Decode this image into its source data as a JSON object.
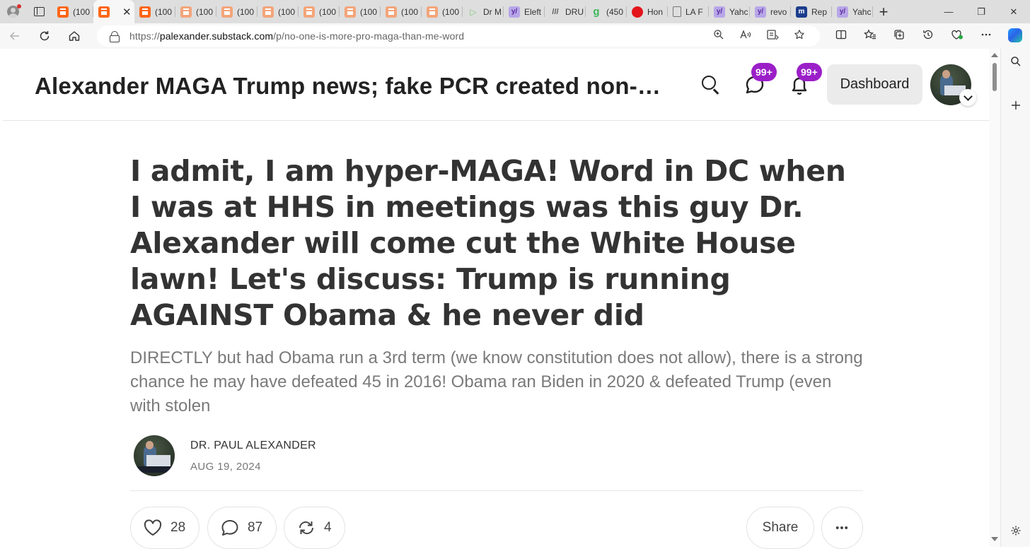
{
  "browser": {
    "tabs": [
      {
        "label": "(100",
        "icon": "substack-icon",
        "active": false
      },
      {
        "label": "",
        "icon": "substack-icon",
        "active": true
      },
      {
        "label": "(100",
        "icon": "substack-icon",
        "active": false
      },
      {
        "label": "(100",
        "icon": "substack-icon",
        "active": false
      },
      {
        "label": "(100",
        "icon": "substack-icon",
        "active": false
      },
      {
        "label": "(100",
        "icon": "substack-icon",
        "active": false
      },
      {
        "label": "(100",
        "icon": "substack-icon",
        "active": false
      },
      {
        "label": "(100",
        "icon": "substack-icon",
        "active": false
      },
      {
        "label": "(100",
        "icon": "substack-icon",
        "active": false
      },
      {
        "label": "(100",
        "icon": "substack-icon",
        "active": false
      },
      {
        "label": "Dr M",
        "icon": "play-icon",
        "active": false
      },
      {
        "label": "Eleft",
        "icon": "yahoo-icon",
        "active": false
      },
      {
        "label": "DRU",
        "icon": "drudge-icon",
        "active": false
      },
      {
        "label": "(450",
        "icon": "green-g-icon",
        "active": false
      },
      {
        "label": "Hon",
        "icon": "red-circle-icon",
        "active": false
      },
      {
        "label": "LA F",
        "icon": "document-icon",
        "active": false
      },
      {
        "label": "Yahc",
        "icon": "yahoo-icon",
        "active": false
      },
      {
        "label": "revo",
        "icon": "yahoo-icon",
        "active": false
      },
      {
        "label": "Rep",
        "icon": "rep-icon",
        "active": false
      },
      {
        "label": "Yahc",
        "icon": "yahoo-icon",
        "active": false
      }
    ],
    "close_glyph": "✕",
    "new_tab_glyph": "+",
    "window_controls": {
      "minimize": "—",
      "restore": "❐",
      "close": "✕"
    },
    "url": {
      "scheme": "https://",
      "host": "palexander.substack.com",
      "path": "/p/no-one-is-more-pro-maga-than-me-word"
    }
  },
  "site": {
    "title": "Alexander MAGA Trump news; fake PCR created non-pandemic...",
    "chat_badge": "99+",
    "notifications_badge": "99+",
    "dashboard_label": "Dashboard"
  },
  "post": {
    "title": "I admit, I am hyper-MAGA! Word in DC when I was at HHS in meetings was this guy Dr. Alexander will come cut the White House lawn! Let's discuss: Trump is running AGAINST Obama & he never did",
    "subtitle": "DIRECTLY but had Obama run a 3rd term (we know constitution does not allow), there is a strong chance he may have defeated 45 in 2016! Obama ran Biden in 2020 & defeated Trump (even with stolen",
    "author": "DR. PAUL ALEXANDER",
    "date": "AUG 19, 2024",
    "likes": "28",
    "comments": "87",
    "restacks": "4",
    "share_label": "Share",
    "more_glyph": "•••"
  },
  "colors": {
    "badge": "#9b1fc8",
    "substack_orange": "#ff6719",
    "tabstrip": "#dedede",
    "toolbar": "#f7f7f7"
  }
}
